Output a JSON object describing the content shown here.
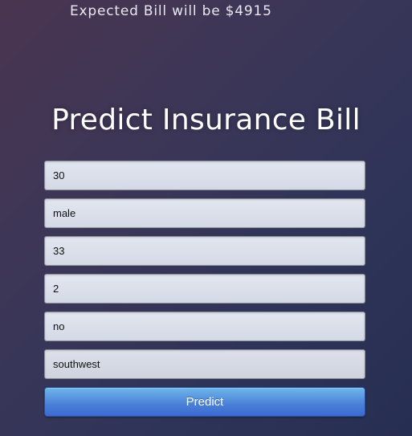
{
  "result": {
    "text": "Expected Bill will be $4915"
  },
  "title": "Predict Insurance Bill",
  "form": {
    "fields": [
      {
        "value": "30"
      },
      {
        "value": "male"
      },
      {
        "value": "33"
      },
      {
        "value": "2"
      },
      {
        "value": "no"
      },
      {
        "value": "southwest"
      }
    ],
    "submit_label": "Predict"
  }
}
